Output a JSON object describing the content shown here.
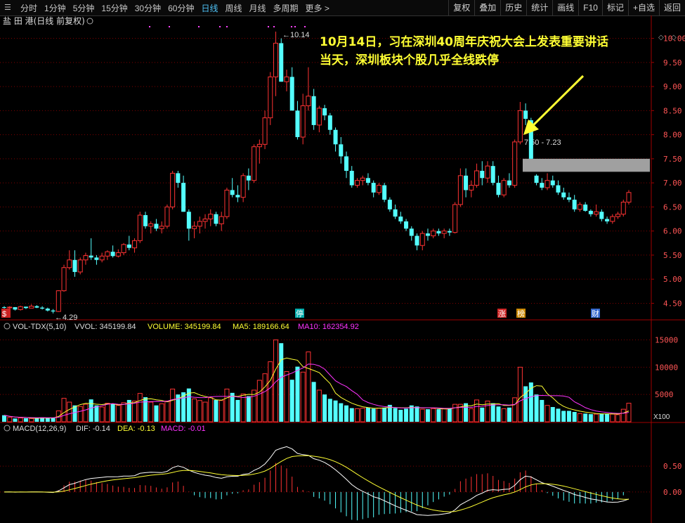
{
  "toolbar": {
    "tabs": [
      "分时",
      "1分钟",
      "5分钟",
      "15分钟",
      "30分钟",
      "60分钟",
      "日线",
      "周线",
      "月线",
      "多周期",
      "更多 >"
    ],
    "active_tab": "日线",
    "right_buttons": [
      "复权",
      "叠加",
      "历史",
      "统计",
      "画线",
      "F10",
      "标记",
      "+自选",
      "返回"
    ]
  },
  "colors": {
    "up": "#ff3333",
    "down": "#54ffff",
    "yellow": "#ffff33",
    "magenta": "#ff33ff",
    "white": "#ffffff",
    "grid": "#800000",
    "axis": "#a00000"
  },
  "annotation": {
    "line1": "10月14日，习在深圳40周年庆祝大会上发表重要讲话",
    "line2": "当天，深圳板块个股几乎全线跌停"
  },
  "chart_data": [
    {
      "type": "candlestick",
      "title": "盐 田 港(日线 前复权)",
      "ylim": [
        4.2,
        10.3
      ],
      "yticks": [
        4.5,
        5.0,
        5.5,
        6.0,
        6.5,
        7.0,
        7.5,
        8.0,
        8.5,
        9.0,
        9.5,
        10.0
      ],
      "high_label": "10.14",
      "low_label": "4.29",
      "gap_label": "7.50 - 7.23",
      "gap_range": [
        7.23,
        7.5
      ],
      "markers": [
        "停",
        "$",
        "涨",
        "榜",
        "财"
      ],
      "candles": [
        [
          4.42,
          4.44,
          4.39,
          4.41
        ],
        [
          4.41,
          4.44,
          4.39,
          4.42
        ],
        [
          4.42,
          4.42,
          4.35,
          4.37
        ],
        [
          4.37,
          4.45,
          4.35,
          4.43
        ],
        [
          4.43,
          4.43,
          4.38,
          4.4
        ],
        [
          4.4,
          4.48,
          4.4,
          4.44
        ],
        [
          4.44,
          4.46,
          4.4,
          4.41
        ],
        [
          4.41,
          4.44,
          4.37,
          4.39
        ],
        [
          4.39,
          4.41,
          4.33,
          4.35
        ],
        [
          4.35,
          4.38,
          4.29,
          4.33
        ],
        [
          4.33,
          4.77,
          4.32,
          4.76
        ],
        [
          4.76,
          5.3,
          4.74,
          5.24
        ],
        [
          5.24,
          5.6,
          5.2,
          5.4
        ],
        [
          5.4,
          5.6,
          5.05,
          5.15
        ],
        [
          5.15,
          5.45,
          5.1,
          5.4
        ],
        [
          5.4,
          5.55,
          5.3,
          5.49
        ],
        [
          5.49,
          5.85,
          5.4,
          5.45
        ],
        [
          5.45,
          5.5,
          5.3,
          5.4
        ],
        [
          5.4,
          5.55,
          5.35,
          5.48
        ],
        [
          5.48,
          5.6,
          5.4,
          5.57
        ],
        [
          5.57,
          5.7,
          5.45,
          5.48
        ],
        [
          5.48,
          5.62,
          5.45,
          5.55
        ],
        [
          5.55,
          5.75,
          5.5,
          5.72
        ],
        [
          5.72,
          5.9,
          5.6,
          5.65
        ],
        [
          5.65,
          5.85,
          5.55,
          5.8
        ],
        [
          5.8,
          6.4,
          5.75,
          6.33
        ],
        [
          6.33,
          6.4,
          6.05,
          6.1
        ],
        [
          6.1,
          6.2,
          5.95,
          6.15
        ],
        [
          6.15,
          6.25,
          6.0,
          6.05
        ],
        [
          6.05,
          6.2,
          5.95,
          6.1
        ],
        [
          6.1,
          6.55,
          6.05,
          6.5
        ],
        [
          6.5,
          7.25,
          6.45,
          7.2
        ],
        [
          7.2,
          7.25,
          6.9,
          7.0
        ],
        [
          7.0,
          7.15,
          6.4,
          6.4
        ],
        [
          6.4,
          6.45,
          5.8,
          6.05
        ],
        [
          6.05,
          6.2,
          5.85,
          6.1
        ],
        [
          6.1,
          6.3,
          5.95,
          6.2
        ],
        [
          6.2,
          6.35,
          6.05,
          6.25
        ],
        [
          6.25,
          6.45,
          6.1,
          6.35
        ],
        [
          6.35,
          6.4,
          6.1,
          6.15
        ],
        [
          6.15,
          6.4,
          6.0,
          6.3
        ],
        [
          6.3,
          6.9,
          6.25,
          6.85
        ],
        [
          6.85,
          7.1,
          6.7,
          6.75
        ],
        [
          6.75,
          6.95,
          6.6,
          6.7
        ],
        [
          6.7,
          7.2,
          6.6,
          7.15
        ],
        [
          7.15,
          7.3,
          6.85,
          7.05
        ],
        [
          7.05,
          7.8,
          7.0,
          7.75
        ],
        [
          7.75,
          7.9,
          7.4,
          7.8
        ],
        [
          7.8,
          8.5,
          7.7,
          8.35
        ],
        [
          8.35,
          9.3,
          8.2,
          9.2
        ],
        [
          9.2,
          10.14,
          8.8,
          9.9
        ],
        [
          9.9,
          10.0,
          9.1,
          9.1
        ],
        [
          9.1,
          9.35,
          8.9,
          9.2
        ],
        [
          9.2,
          9.4,
          8.6,
          8.5
        ],
        [
          8.5,
          8.7,
          7.9,
          7.95
        ],
        [
          7.95,
          8.85,
          7.8,
          8.6
        ],
        [
          8.6,
          9.4,
          8.5,
          8.8
        ],
        [
          8.8,
          8.95,
          8.1,
          8.2
        ],
        [
          8.2,
          8.6,
          8.05,
          8.55
        ],
        [
          8.55,
          8.62,
          8.3,
          8.4
        ],
        [
          8.4,
          8.45,
          8.0,
          8.1
        ],
        [
          8.1,
          8.15,
          7.65,
          7.8
        ],
        [
          7.8,
          7.95,
          7.4,
          7.55
        ],
        [
          7.55,
          7.65,
          7.1,
          7.25
        ],
        [
          7.25,
          7.35,
          6.9,
          6.95
        ],
        [
          6.95,
          7.1,
          6.9,
          7.05
        ],
        [
          7.05,
          7.15,
          6.95,
          7.1
        ],
        [
          7.1,
          7.2,
          6.95,
          7.0
        ],
        [
          7.0,
          7.05,
          6.7,
          6.8
        ],
        [
          6.8,
          7.0,
          6.75,
          6.95
        ],
        [
          6.95,
          7.0,
          6.6,
          6.65
        ],
        [
          6.65,
          6.7,
          6.4,
          6.45
        ],
        [
          6.45,
          6.55,
          6.25,
          6.3
        ],
        [
          6.3,
          6.4,
          6.15,
          6.2
        ],
        [
          6.2,
          6.25,
          6.0,
          6.05
        ],
        [
          6.05,
          6.1,
          5.8,
          5.9
        ],
        [
          5.9,
          5.95,
          5.6,
          5.7
        ],
        [
          5.7,
          6.0,
          5.6,
          5.95
        ],
        [
          5.95,
          6.05,
          5.8,
          5.9
        ],
        [
          5.9,
          6.05,
          5.85,
          6.0
        ],
        [
          6.0,
          6.05,
          5.9,
          5.95
        ],
        [
          5.95,
          6.05,
          5.85,
          6.0
        ],
        [
          6.0,
          6.05,
          5.9,
          5.97
        ],
        [
          5.97,
          6.6,
          5.95,
          6.55
        ],
        [
          6.55,
          7.3,
          6.5,
          7.15
        ],
        [
          7.15,
          7.3,
          6.7,
          6.85
        ],
        [
          6.85,
          7.05,
          6.7,
          6.95
        ],
        [
          6.95,
          7.4,
          6.9,
          7.25
        ],
        [
          7.25,
          7.45,
          6.95,
          7.1
        ],
        [
          7.1,
          7.45,
          7.0,
          7.35
        ],
        [
          7.35,
          7.45,
          6.95,
          7.0
        ],
        [
          7.0,
          7.15,
          6.7,
          6.75
        ],
        [
          6.75,
          7.1,
          6.7,
          7.05
        ],
        [
          7.05,
          7.2,
          6.9,
          6.95
        ],
        [
          6.95,
          7.9,
          6.9,
          7.85
        ],
        [
          7.85,
          8.68,
          7.8,
          8.5
        ],
        [
          8.5,
          8.65,
          8.2,
          8.33
        ],
        [
          8.3,
          8.35,
          7.5,
          7.5
        ],
        [
          7.15,
          7.18,
          6.95,
          7.0
        ],
        [
          7.0,
          7.1,
          6.85,
          6.9
        ],
        [
          6.9,
          7.2,
          6.85,
          7.05
        ],
        [
          7.05,
          7.15,
          6.9,
          6.95
        ],
        [
          6.95,
          7.05,
          6.75,
          6.8
        ],
        [
          6.8,
          6.9,
          6.65,
          6.7
        ],
        [
          6.7,
          6.8,
          6.6,
          6.65
        ],
        [
          6.65,
          6.75,
          6.4,
          6.45
        ],
        [
          6.45,
          6.6,
          6.4,
          6.55
        ],
        [
          6.55,
          6.6,
          6.4,
          6.42
        ],
        [
          6.42,
          6.45,
          6.3,
          6.35
        ],
        [
          6.35,
          6.55,
          6.3,
          6.4
        ],
        [
          6.4,
          6.45,
          6.2,
          6.25
        ],
        [
          6.25,
          6.3,
          6.15,
          6.2
        ],
        [
          6.2,
          6.35,
          6.15,
          6.3
        ],
        [
          6.3,
          6.4,
          6.25,
          6.35
        ],
        [
          6.35,
          6.65,
          6.3,
          6.6
        ],
        [
          6.6,
          6.85,
          6.55,
          6.8
        ]
      ]
    },
    {
      "type": "bar",
      "title": "VOL-TDX(5,10)",
      "labels": [
        "VVOL: 345199.84",
        "VOLUME: 345199.84",
        "MA5: 189166.64",
        "MA10: 162354.92"
      ],
      "ylim": [
        0,
        17000
      ],
      "yticks": [
        5000,
        10000,
        15000
      ],
      "unit_label": "X100",
      "values": [
        1200,
        800,
        600,
        700,
        650,
        600,
        700,
        800,
        650,
        700,
        2000,
        4300,
        3600,
        3000,
        2800,
        3200,
        4100,
        3000,
        2700,
        3400,
        3300,
        3000,
        3500,
        4000,
        3800,
        5200,
        4500,
        3600,
        3000,
        3300,
        3800,
        6000,
        5000,
        5400,
        6100,
        4200,
        3900,
        3600,
        4400,
        4000,
        3900,
        6000,
        5300,
        4000,
        5100,
        4700,
        5800,
        7600,
        8800,
        11000,
        15000,
        14400,
        9200,
        7700,
        10100,
        9100,
        12800,
        7300,
        5800,
        5000,
        4200,
        3900,
        3400,
        3000,
        2500,
        2400,
        2500,
        2600,
        2400,
        2500,
        2600,
        3100,
        2500,
        2200,
        2400,
        3000,
        2800,
        2300,
        2300,
        2400,
        2300,
        2400,
        2500,
        3200,
        3200,
        3400,
        2400,
        4000,
        2600,
        3800,
        3400,
        2800,
        2400,
        2600,
        4400,
        10000,
        6500,
        7200,
        5000,
        4000,
        3000,
        2700,
        2400,
        2000,
        2000,
        1800,
        1500,
        1500,
        1400,
        1400,
        1500,
        1500,
        1400,
        1300,
        2300,
        3400
      ]
    },
    {
      "type": "line",
      "title": "MACD(12,26,9)",
      "labels": [
        "DIF: -0.14",
        "DEA: -0.13",
        "MACD: -0.01"
      ],
      "ylim": [
        -0.6,
        1.1
      ],
      "yticks": [
        0.0,
        0.5
      ]
    }
  ]
}
